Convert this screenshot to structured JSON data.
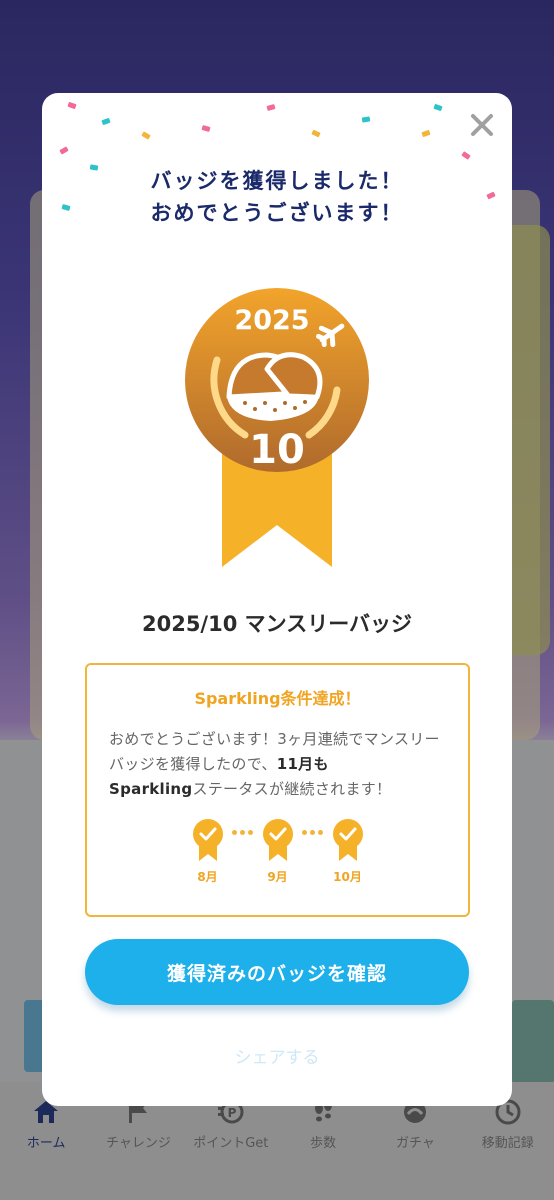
{
  "modal": {
    "title_line1": "バッジを獲得しました！",
    "title_line2": "おめでとうございます！",
    "badge": {
      "year": "2025",
      "month_number": "10",
      "icon_names": [
        "airplane-icon",
        "chestnut-icon"
      ],
      "colors": {
        "top": "#f2a42b",
        "bottom": "#b06a2c",
        "ribbon": "#f5b229",
        "ring": "#ffd98a"
      }
    },
    "badge_name": "2025/10 マンスリーバッジ",
    "info": {
      "title": "Sparkling条件達成！",
      "text_part1": "おめでとうございます！3ヶ月連続でマンスリーバッジを獲得したので、",
      "text_bold1": "11月も",
      "text_bold2": "Sparkling",
      "text_part2": "ステータスが継続されます！",
      "months": [
        "8月",
        "9月",
        "10月"
      ]
    },
    "primary_button": "獲得済みのバッジを確認",
    "share_link": "シェアする",
    "accent_color": "#1eb0ea"
  },
  "bottom_nav": {
    "items": [
      {
        "label": "ホーム",
        "icon": "home-icon"
      },
      {
        "label": "チャレンジ",
        "icon": "flag-icon"
      },
      {
        "label": "ポイントGet",
        "icon": "points-icon"
      },
      {
        "label": "歩数",
        "icon": "footprints-icon"
      },
      {
        "label": "ガチャ",
        "icon": "gacha-icon"
      },
      {
        "label": "移動記録",
        "icon": "history-icon"
      }
    ]
  }
}
